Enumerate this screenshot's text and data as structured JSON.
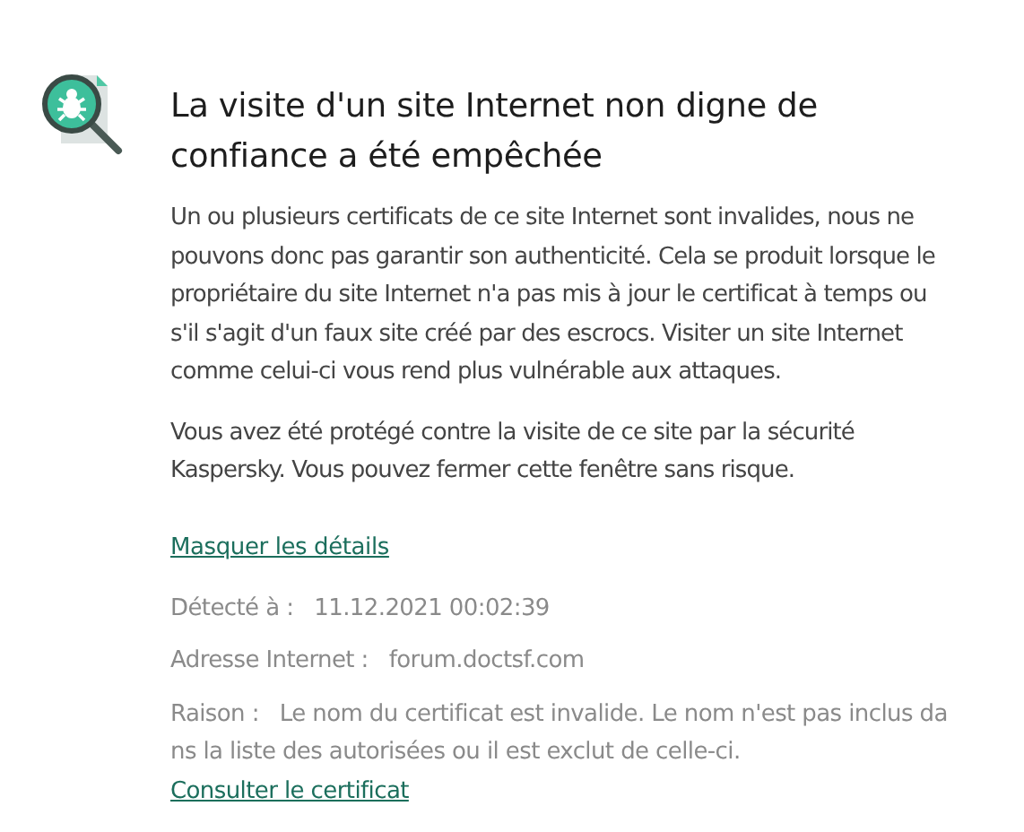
{
  "title": "La visite d'un site Internet non digne de confiance a été empêchée",
  "paragraphs": [
    "Un ou plusieurs certificats de ce site Internet sont invalides, nous ne pouvons donc pas garantir son authenticité. Cela se produit lorsque le propriétaire du site Internet n'a pas mis à jour le certificat à temps ou s'il s'agit d'un faux site créé par des escrocs. Visiter un site Internet comme celui-ci vous rend plus vulnérable aux attaques.",
    "Vous avez été protégé contre la visite de ce site par la sécurité Kaspersky. Vous pouvez fermer cette fenêtre sans risque."
  ],
  "details_link": "Masquer les détails",
  "details": [
    {
      "label": "Détecté à :",
      "value": "11.12.2021 00:02:39"
    },
    {
      "label": "Adresse Internet :",
      "value": "forum.doctsf.com"
    },
    {
      "label": "Raison :",
      "value": "Le nom du certificat est invalide. Le nom n'est pas inclus dans la liste des autorisées ou il est exclut de celle-ci.",
      "link": "Consulter le certificat"
    }
  ]
}
